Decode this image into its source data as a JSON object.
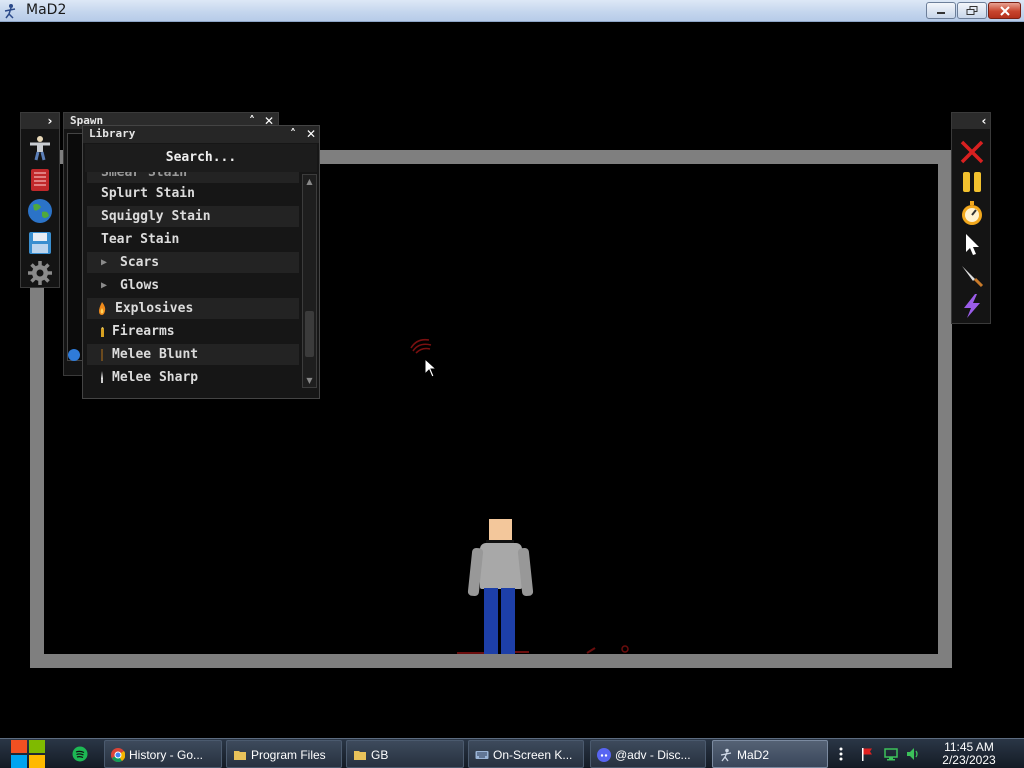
{
  "window": {
    "title": "MaD2"
  },
  "spawn_panel": {
    "title": "Spawn"
  },
  "library": {
    "title": "Library",
    "search_label": "Search...",
    "items": [
      {
        "label": "Smear Stain",
        "kind": "item"
      },
      {
        "label": "Splurt Stain",
        "kind": "item"
      },
      {
        "label": "Squiggly Stain",
        "kind": "item"
      },
      {
        "label": "Tear Stain",
        "kind": "item"
      },
      {
        "label": "Scars",
        "kind": "folder"
      },
      {
        "label": "Glows",
        "kind": "folder"
      },
      {
        "label": "Explosives",
        "kind": "category",
        "icon": "flame-icon"
      },
      {
        "label": "Firearms",
        "kind": "category",
        "icon": "bullet-icon"
      },
      {
        "label": "Melee Blunt",
        "kind": "category",
        "icon": "bat-icon"
      },
      {
        "label": "Melee Sharp",
        "kind": "category",
        "icon": "knife-icon"
      }
    ]
  },
  "left_toolbar": [
    "ragdoll-icon",
    "book-icon",
    "globe-icon",
    "save-icon",
    "gear-icon"
  ],
  "right_toolbar": [
    "delete-icon",
    "pause-icon",
    "stopwatch-icon",
    "pointer-icon",
    "knife-tool-icon",
    "lightning-icon"
  ],
  "taskbar": {
    "items": [
      {
        "label": "History - Go...",
        "icon": "chrome-icon"
      },
      {
        "label": "Program Files",
        "icon": "folder-icon"
      },
      {
        "label": "GB",
        "icon": "folder-icon"
      },
      {
        "label": "On-Screen K...",
        "icon": "keyboard-icon"
      },
      {
        "label": "@adv - Disc...",
        "icon": "discord-icon"
      },
      {
        "label": "MaD2",
        "icon": "mad2-icon"
      }
    ],
    "clock_time": "11:45 AM",
    "clock_date": "2/23/2023"
  },
  "colors": {
    "arena_border": "#7f7f7f",
    "blood": "#8b1010",
    "shirt": "#a8a8a8",
    "pants": "#1d3fa8",
    "skin": "#f3c79b"
  }
}
